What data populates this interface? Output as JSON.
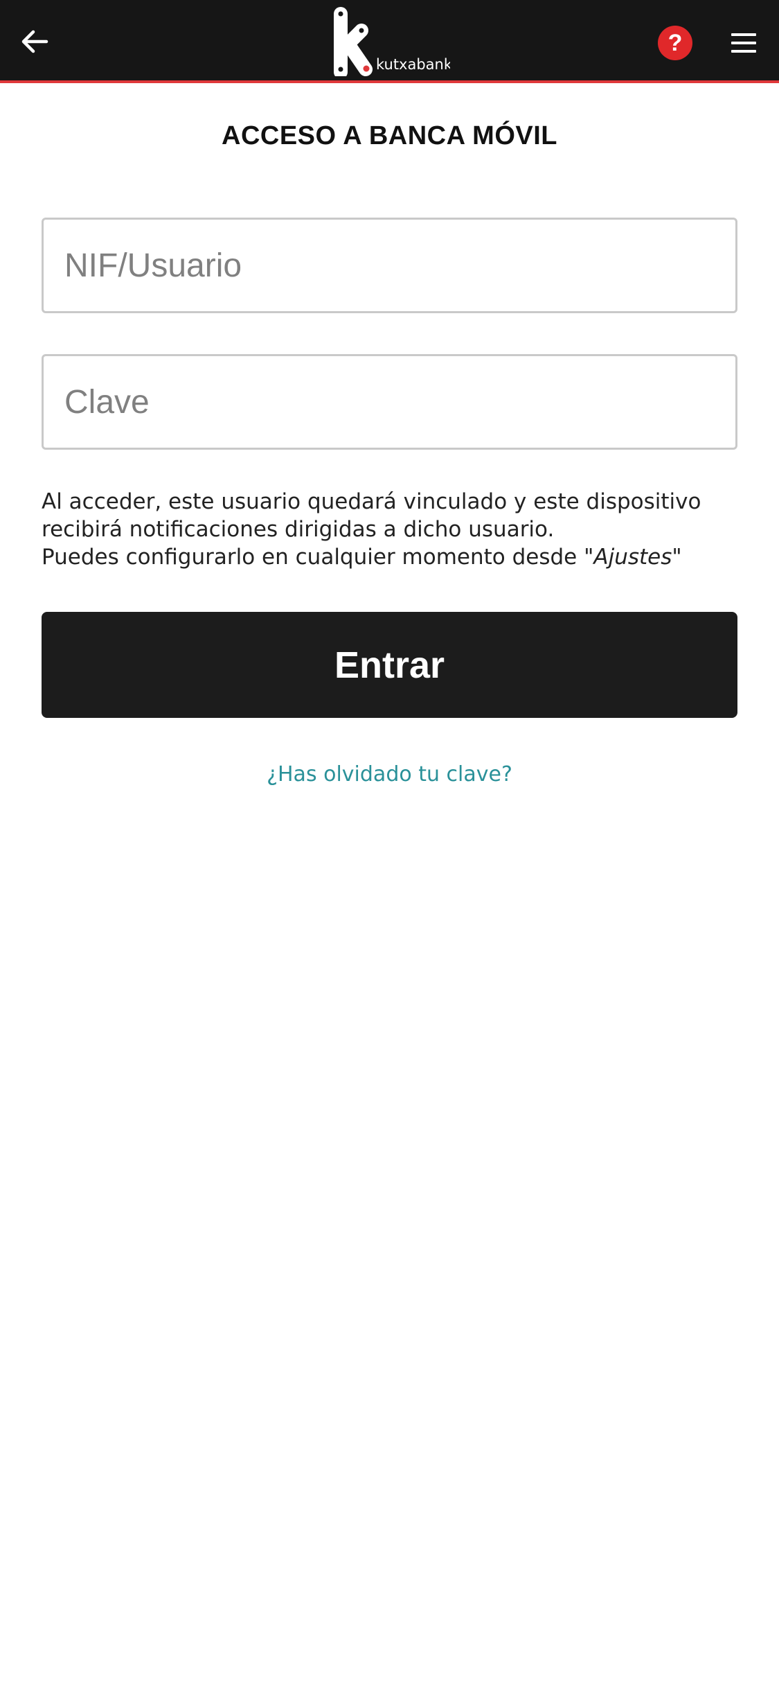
{
  "header": {
    "back_icon": "arrow-left-icon",
    "brand": {
      "logo_letter": "k",
      "name": "kutxabank"
    },
    "help_label": "?",
    "menu_icon": "hamburger-menu-icon",
    "accent_color": "#e0383a"
  },
  "page": {
    "title": "ACCESO A BANCA MÓVIL"
  },
  "form": {
    "user_field": {
      "placeholder": "NIF/Usuario",
      "value": ""
    },
    "password_field": {
      "placeholder": "Clave",
      "value": ""
    },
    "notice": {
      "line1": "Al acceder, este usuario quedará vinculado y este dispositivo recibirá notificaciones dirigidas a dicho usuario.",
      "line2_prefix": "Puedes configurarlo en cualquier momento desde ",
      "line2_settings": "\"Ajustes\""
    },
    "submit_label": "Entrar",
    "forgot_label": "¿Has olvidado tu clave?",
    "link_color": "#2a9199"
  }
}
